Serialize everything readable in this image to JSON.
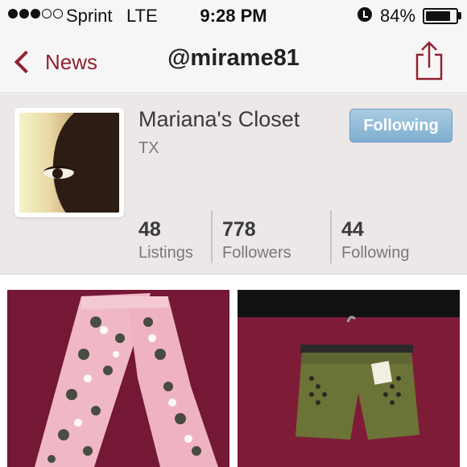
{
  "status_bar": {
    "carrier": "Sprint",
    "network": "LTE",
    "time": "9:28 PM",
    "battery_percent": "84%",
    "battery_level": 0.84,
    "signal_bars": 3,
    "signal_bars_total": 5
  },
  "nav": {
    "back_label": "News",
    "title": "@mirame81",
    "share_icon": "share-icon",
    "accent_color": "#8e2330"
  },
  "profile": {
    "closet_name": "Mariana's Closet",
    "location": "TX",
    "follow_button_label": "Following",
    "stats": [
      {
        "count": "48",
        "label": "Listings"
      },
      {
        "count": "778",
        "label": "Followers"
      },
      {
        "count": "44",
        "label": "Following"
      }
    ]
  },
  "listings": [
    {
      "kind": "floral-pants"
    },
    {
      "kind": "olive-shorts"
    }
  ]
}
